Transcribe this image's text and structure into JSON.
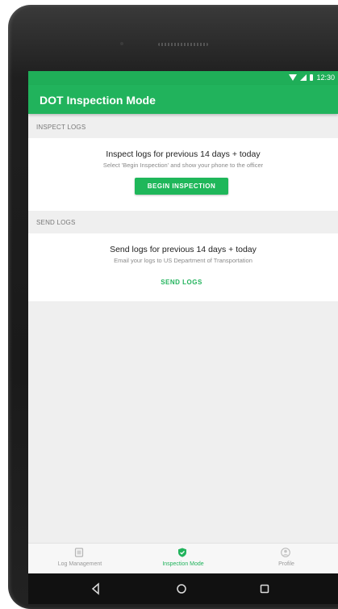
{
  "status": {
    "time": "12:30"
  },
  "appbar": {
    "title": "DOT Inspection Mode"
  },
  "inspect": {
    "header": "INSPECT LOGS",
    "title": "Inspect logs for previous 14 days + today",
    "subtitle": "Select 'Begin Inspection' and show your phone to the officer",
    "button": "BEGIN INSPECTION"
  },
  "send": {
    "header": "SEND LOGS",
    "title": "Send logs for previous 14 days + today",
    "subtitle": "Email your logs to US Department of Transportation",
    "button": "SEND LOGS"
  },
  "bottom_nav": {
    "items": [
      {
        "label": "Log Management",
        "icon": "document-icon",
        "active": false
      },
      {
        "label": "Inspection Mode",
        "icon": "shield-check-icon",
        "active": true
      },
      {
        "label": "Profile",
        "icon": "person-icon",
        "active": false
      }
    ]
  },
  "colors": {
    "accent": "#21b35c",
    "status_bar": "#1fae58",
    "background": "#efefef"
  }
}
